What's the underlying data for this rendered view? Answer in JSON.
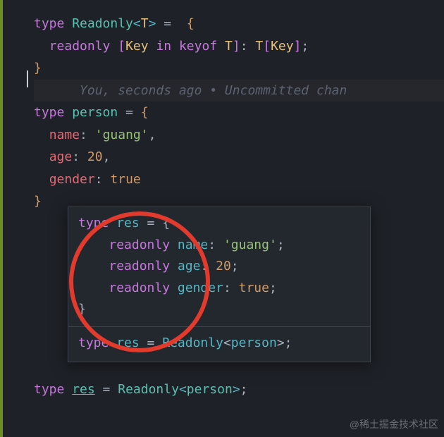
{
  "editor": {
    "git_blame": "You, seconds ago • Uncommitted chan",
    "code": {
      "l1": {
        "kw": "type",
        "name": "Readonly",
        "lt": "<",
        "tp": "T",
        "gt": ">",
        "eq": " =  ",
        "brace": "{"
      },
      "l2": {
        "mod": "readonly",
        "br_o": "[",
        "key": "Key",
        "in_kw": "in",
        "keyof_kw": "keyof",
        "tp": "T",
        "br_c": "]",
        "colon": ":",
        "tp2": "T",
        "br2_o": "[",
        "key2": "Key",
        "br2_c": "]",
        "semi": ";"
      },
      "l3": {
        "brace": "}"
      },
      "l4_empty": "",
      "l5": {
        "kw": "type",
        "name": "person",
        "eq": " = ",
        "brace": "{"
      },
      "l6": {
        "prop": "name",
        "colon": ":",
        "val": "'guang'",
        "comma": ","
      },
      "l7": {
        "prop": "age",
        "colon": ":",
        "val": "20",
        "comma": ","
      },
      "l8": {
        "prop": "gender",
        "colon": ":",
        "val": "true"
      },
      "l9": {
        "brace": "}"
      },
      "l10": {
        "kw": "type",
        "name": "res",
        "eq": " = ",
        "fn": "Readonly",
        "lt": "<",
        "arg": "person",
        "gt": ">",
        "semi": ";"
      }
    }
  },
  "hover": {
    "l1": {
      "kw": "type",
      "name": "res",
      "eq": " = ",
      "brace": "{"
    },
    "l2": {
      "mod": "readonly",
      "prop": "name",
      "colon": ":",
      "val": "'guang'",
      "semi": ";"
    },
    "l3": {
      "mod": "readonly",
      "prop": "age",
      "colon": ":",
      "val": "20",
      "semi": ";"
    },
    "l4": {
      "mod": "readonly",
      "prop": "gender",
      "colon": ":",
      "val": "true",
      "semi": ";"
    },
    "l5": {
      "brace": "}"
    },
    "def": {
      "kw": "type",
      "name": "res",
      "eq": " = ",
      "fn": "Readonly",
      "lt": "<",
      "arg": "person",
      "gt": ">",
      "semi": ";"
    }
  },
  "watermark": "@稀土掘金技术社区"
}
